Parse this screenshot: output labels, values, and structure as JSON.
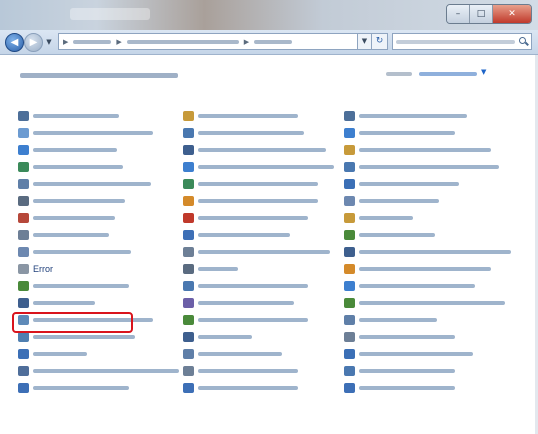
{
  "window": {
    "title": ""
  },
  "titlebar": {
    "buttons": [
      {
        "icon": "minimize-icon"
      },
      {
        "icon": "maximize-icon"
      },
      {
        "icon": "close-icon"
      }
    ]
  },
  "navbar": {
    "address": {
      "breadcrumbs": [
        "",
        "",
        ""
      ]
    },
    "search": {
      "placeholder": ""
    }
  },
  "page": {
    "title": "",
    "view_by_label": "",
    "view_by_value": ""
  },
  "colors": {
    "link": "#1e3f7a",
    "highlight": "#d9141c",
    "accent": "#1e64c8"
  },
  "items": {
    "columns": [
      [
        {
          "label": "",
          "icon": "admin-tools-icon",
          "icon_color": "#4d6f99"
        },
        {
          "label": "",
          "icon": "programs-icon",
          "icon_color": "#6c9bd1"
        },
        {
          "label": "",
          "icon": "folder-icon",
          "icon_color": "#3d7fcf"
        },
        {
          "label": "",
          "icon": "globe-icon",
          "icon_color": "#3b8a5a"
        },
        {
          "label": "",
          "icon": "speech-icon",
          "icon_color": "#5f7fa8"
        },
        {
          "label": "",
          "icon": "devices-icon",
          "icon_color": "#5a6b80"
        },
        {
          "label": "",
          "icon": "firewall-icon",
          "icon_color": "#b6483a"
        },
        {
          "label": "",
          "icon": "gadgets-icon",
          "icon_color": "#6d7f96"
        },
        {
          "label": "",
          "icon": "network-icon",
          "icon_color": "#6d88b0"
        },
        {
          "label": "Error",
          "icon": "error-icon",
          "icon_color": "#8a96a4",
          "highlighted": true
        },
        {
          "label": "",
          "icon": "power-icon",
          "icon_color": "#4a8a3a"
        },
        {
          "label": "",
          "icon": "keyboard-icon",
          "icon_color": "#3e5f8e"
        },
        {
          "label": "",
          "icon": "programs-features-icon",
          "icon_color": "#5e8ab8"
        },
        {
          "label": "",
          "icon": "region-icon",
          "icon_color": "#4f7fb0"
        },
        {
          "label": "",
          "icon": "sound-icon",
          "icon_color": "#3b6fb6"
        },
        {
          "label": "",
          "icon": "troubleshoot-icon",
          "icon_color": "#4f6e9a"
        },
        {
          "label": "",
          "icon": "windows-cardspace-icon",
          "icon_color": "#3d6fb6"
        }
      ],
      [
        {
          "label": "",
          "icon": "credential-icon",
          "icon_color": "#c79a3a"
        },
        {
          "label": "",
          "icon": "backup-icon",
          "icon_color": "#4a78b0"
        },
        {
          "label": "",
          "icon": "action-center-icon",
          "icon_color": "#3e5f8e"
        },
        {
          "label": "",
          "icon": "ease-of-access-icon",
          "icon_color": "#3d7fcf"
        },
        {
          "label": "",
          "icon": "sync-icon",
          "icon_color": "#3b8a5a"
        },
        {
          "label": "",
          "icon": "intel-graphics-icon",
          "icon_color": "#d48a2a"
        },
        {
          "label": "",
          "icon": "mcafee-icon",
          "icon_color": "#c0392b"
        },
        {
          "label": "",
          "icon": "parental-controls-icon",
          "icon_color": "#3d6fb6"
        },
        {
          "label": "",
          "icon": "notification-area-icon",
          "icon_color": "#6d7f96"
        },
        {
          "label": "",
          "icon": "mouse-icon",
          "icon_color": "#5a6b80"
        },
        {
          "label": "",
          "icon": "performance-icon",
          "icon_color": "#4a78b0"
        },
        {
          "label": "",
          "icon": "personalization-icon",
          "icon_color": "#6c5fa8"
        },
        {
          "label": "",
          "icon": "recovery-icon",
          "icon_color": "#4a8a3a"
        },
        {
          "label": "",
          "icon": "system-icon",
          "icon_color": "#3e5f8e"
        },
        {
          "label": "",
          "icon": "taskbar-icon",
          "icon_color": "#5f7fa8"
        },
        {
          "label": "",
          "icon": "phone-modem-icon",
          "icon_color": "#6d7f96"
        },
        {
          "label": "",
          "icon": "windows-defender-icon",
          "icon_color": "#3d6fb6"
        }
      ],
      [
        {
          "label": "",
          "icon": "device-manager-icon",
          "icon_color": "#4d6f99"
        },
        {
          "label": "",
          "icon": "user-accounts-icon",
          "icon_color": "#3d7fcf"
        },
        {
          "label": "",
          "icon": "folder-options-icon",
          "icon_color": "#c79a3a"
        },
        {
          "label": "",
          "icon": "location-sensors-icon",
          "icon_color": "#4a78b0"
        },
        {
          "label": "",
          "icon": "sound-volume-icon",
          "icon_color": "#3b6fb6"
        },
        {
          "label": "",
          "icon": "date-time-icon",
          "icon_color": "#6d88b0"
        },
        {
          "label": "",
          "icon": "fonts-icon",
          "icon_color": "#c79a3a"
        },
        {
          "label": "",
          "icon": "homegroup-icon",
          "icon_color": "#4a8a3a"
        },
        {
          "label": "",
          "icon": "network-sharing-icon",
          "icon_color": "#3e5f8e"
        },
        {
          "label": "",
          "icon": "default-programs-icon",
          "icon_color": "#d48a2a"
        },
        {
          "label": "",
          "icon": "internet-options-icon",
          "icon_color": "#3d7fcf"
        },
        {
          "label": "",
          "icon": "default-settings-icon",
          "icon_color": "#4a8a3a"
        },
        {
          "label": "",
          "icon": "recognition-icon",
          "icon_color": "#5f7fa8"
        },
        {
          "label": "",
          "icon": "speech-recognition-icon",
          "icon_color": "#6d7f96"
        },
        {
          "label": "",
          "icon": "toolbars-icon",
          "icon_color": "#3b6fb6"
        },
        {
          "label": "",
          "icon": "windows-update-icon",
          "icon_color": "#4a78b0"
        },
        {
          "label": "",
          "icon": "windows-update-2-icon",
          "icon_color": "#3d6fb6"
        }
      ]
    ]
  }
}
